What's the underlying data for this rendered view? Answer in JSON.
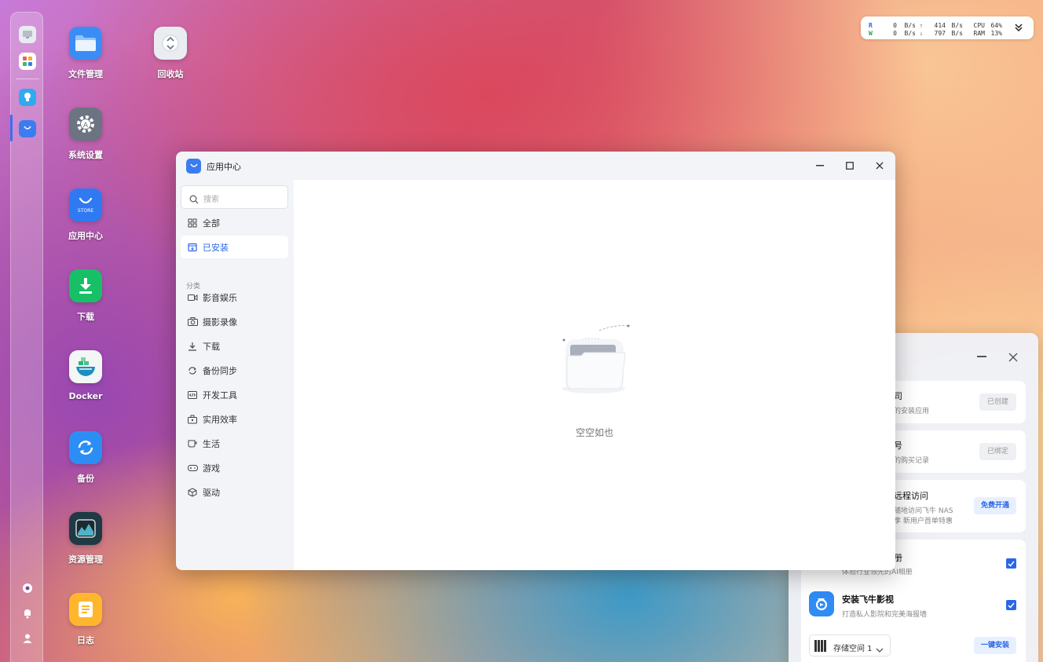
{
  "desktop": {
    "icons": [
      {
        "label": "文件管理",
        "icon": "folder-icon",
        "color": "#3b8df5"
      },
      {
        "label": "回收站",
        "icon": "recycle-bin-icon",
        "color": "#e9edf2"
      },
      {
        "label": "系统设置",
        "icon": "gear-icon",
        "color": "#6b7480"
      },
      {
        "label": "应用中心",
        "icon": "store-icon",
        "color": "#2f7af3"
      },
      {
        "label": "下载",
        "icon": "download-icon",
        "color": "#17c067"
      },
      {
        "label": "Docker",
        "icon": "docker-icon",
        "color": "#f2f6f4"
      },
      {
        "label": "备份",
        "icon": "backup-icon",
        "color": "#2c8ef5"
      },
      {
        "label": "资源管理",
        "icon": "resource-monitor-icon",
        "color": "#1f3a44"
      },
      {
        "label": "日志",
        "icon": "log-icon",
        "color": "#ffb62d"
      }
    ]
  },
  "status": {
    "read_label": "R",
    "write_label": "W",
    "read_disk": "0",
    "write_disk": "0",
    "unit": "B/s",
    "net_up": "414",
    "net_down": "797",
    "cpu_label": "CPU",
    "ram_label": "RAM",
    "cpu_value": "64%",
    "ram_value": "13%"
  },
  "window": {
    "title": "应用中心",
    "search_placeholder": "搜索",
    "nav": [
      {
        "label": "全部",
        "icon": "grid-icon"
      },
      {
        "label": "已安装",
        "icon": "installed-icon"
      }
    ],
    "section_label": "分类",
    "categories": [
      {
        "label": "影音娱乐",
        "icon": "video-icon"
      },
      {
        "label": "摄影录像",
        "icon": "camera-icon"
      },
      {
        "label": "下载",
        "icon": "download-icon"
      },
      {
        "label": "备份同步",
        "icon": "sync-icon"
      },
      {
        "label": "开发工具",
        "icon": "code-icon"
      },
      {
        "label": "实用效率",
        "icon": "toolbox-icon"
      },
      {
        "label": "生活",
        "icon": "coffee-icon"
      },
      {
        "label": "游戏",
        "icon": "gamepad-icon"
      },
      {
        "label": "驱动",
        "icon": "cube-icon"
      }
    ],
    "empty_text": "空空如也"
  },
  "panel": {
    "card1_title": "司",
    "card1_sub": "的安装应用",
    "card1_btn": "已创建",
    "card2_title": "号",
    "card2_sub": "的购买记录",
    "card2_btn": "已绑定",
    "card3_title": "远程访问",
    "card3_sub1": "随地访问飞牛 NAS",
    "card3_sub2": "享 新用户首单特惠",
    "card3_btn": "免费开通",
    "card4_title": "册",
    "card4_sub": "体验行业领先的AI相册",
    "card5_title": "安装飞牛影视",
    "card5_sub": "打造私人影院和完美海报墙",
    "storage_select": "存储空间 1",
    "install_btn": "一键安装"
  }
}
